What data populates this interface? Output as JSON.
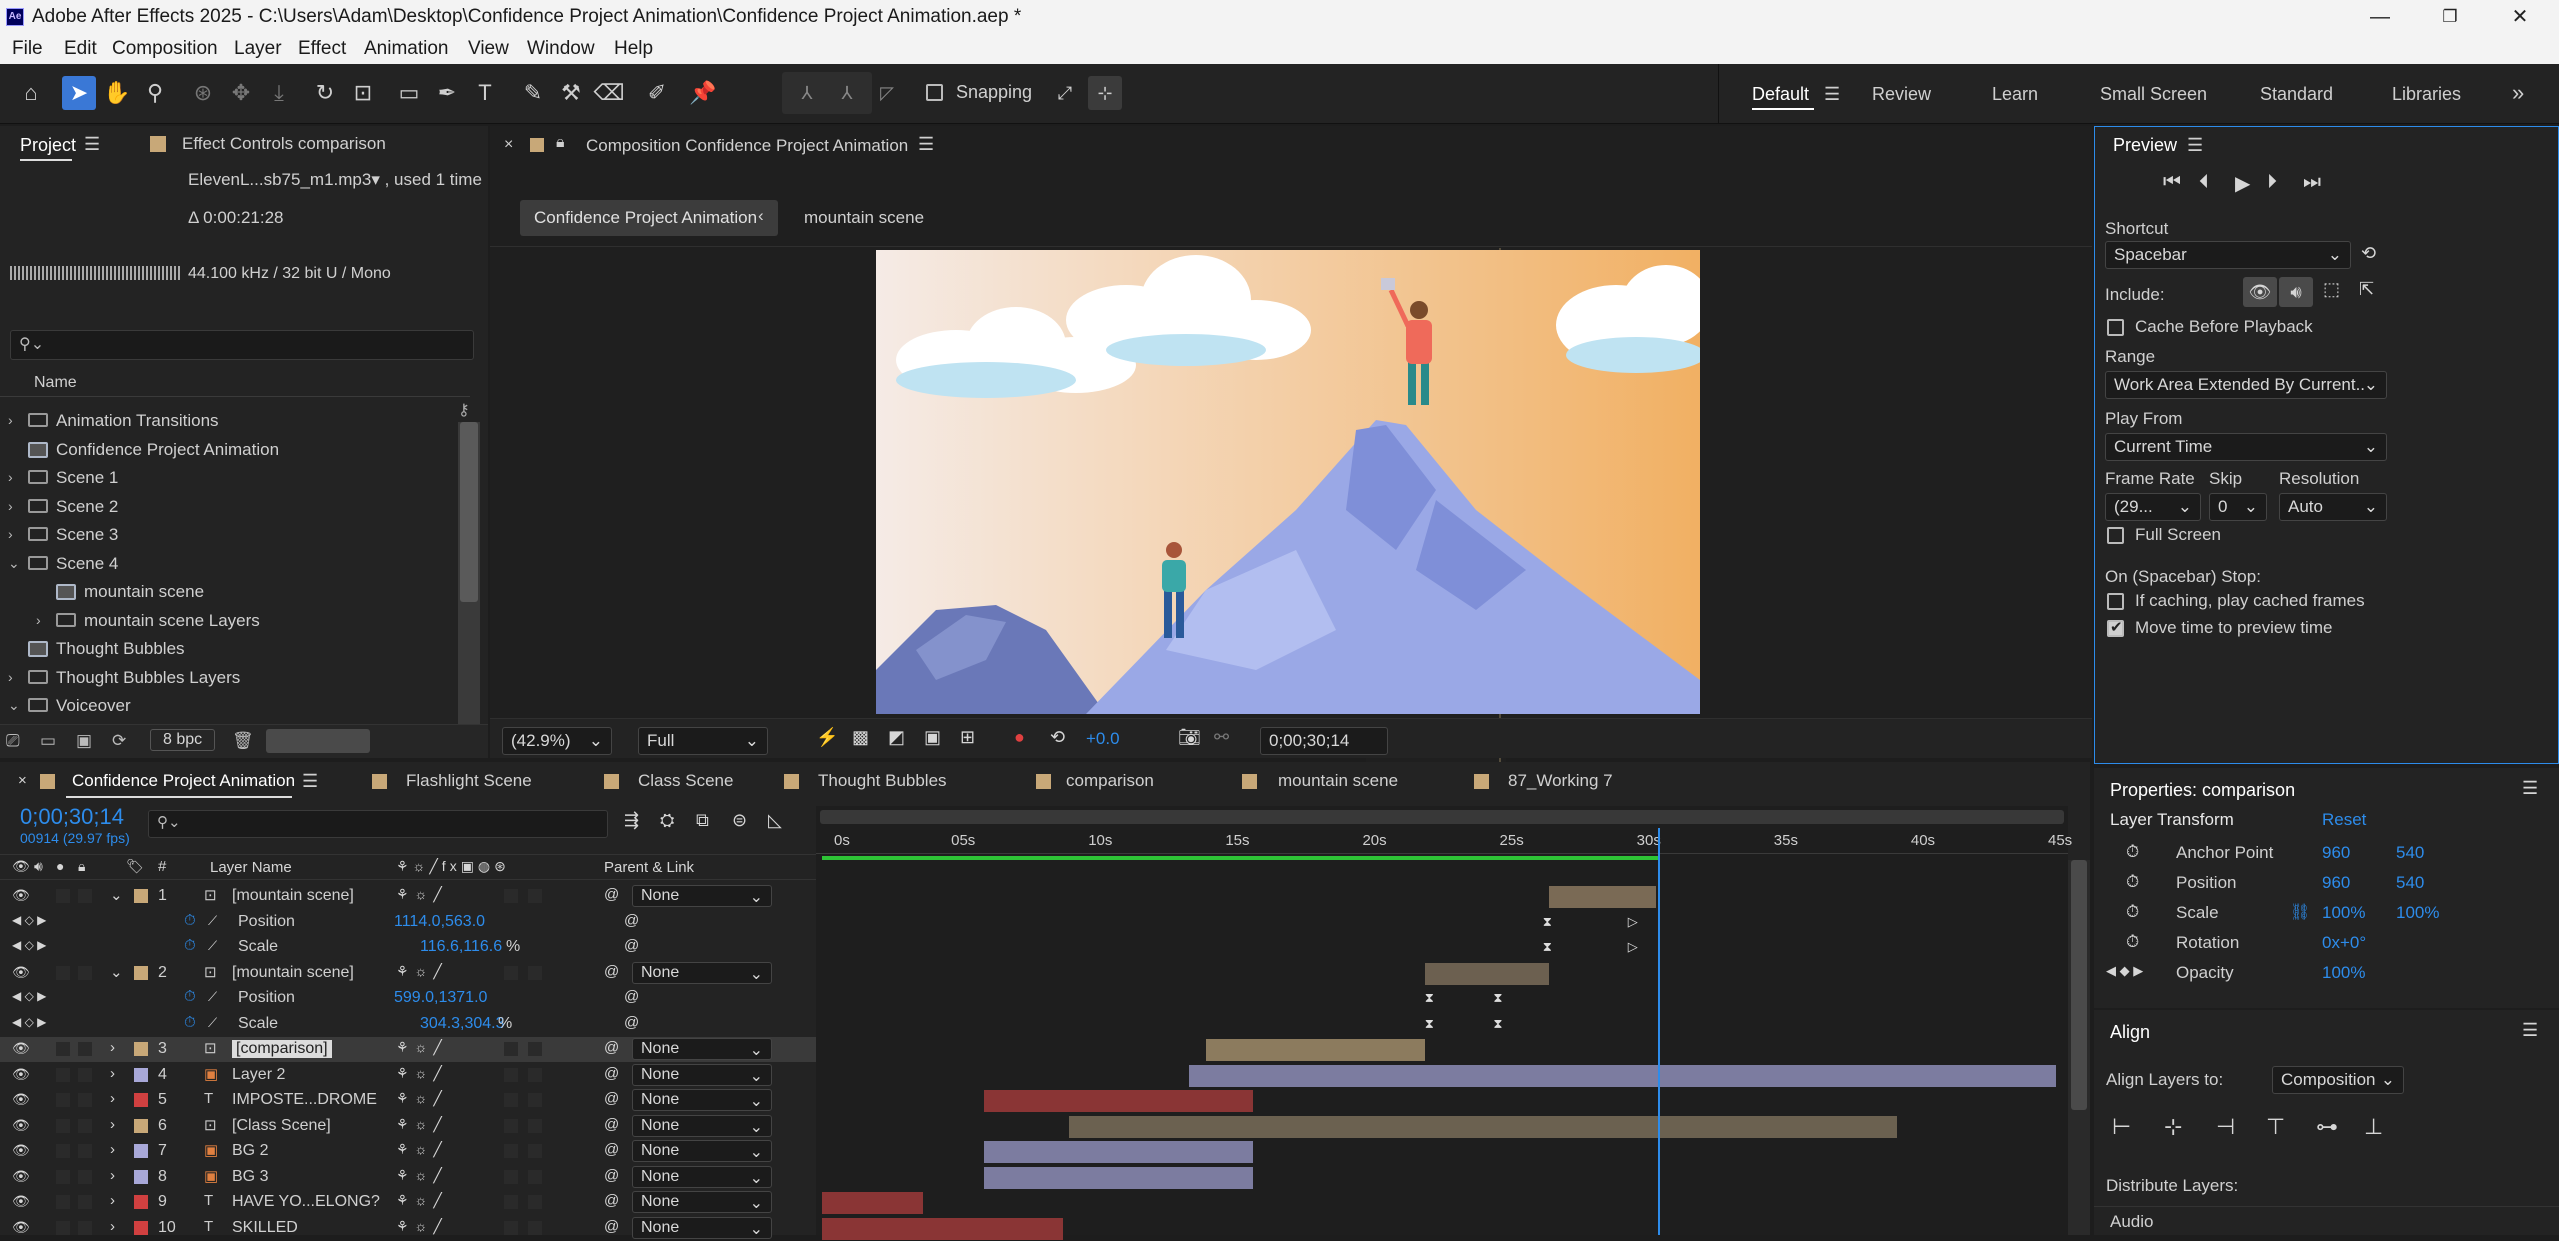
{
  "window": {
    "app_icon": "Ae",
    "title": "Adobe After Effects 2025 - C:\\Users\\Adam\\Desktop\\Confidence Project Animation\\Confidence Project Animation.aep *",
    "minimize": "—",
    "maximize": "❐",
    "close": "✕"
  },
  "menu": [
    "File",
    "Edit",
    "Composition",
    "Layer",
    "Effect",
    "Animation",
    "View",
    "Window",
    "Help"
  ],
  "toolbar": {
    "snapping_label": "Snapping",
    "workspaces": [
      "Default",
      "Review",
      "Learn",
      "Small Screen",
      "Standard",
      "Libraries"
    ],
    "active_workspace": "Default",
    "more": "»"
  },
  "project": {
    "tab_label": "Project",
    "effect_controls_label": "Effect Controls comparison",
    "file_name": "ElevenL...sb75_m1.mp3▾ , used 1 time",
    "duration": "Δ 0:00:21:28",
    "audio_info": "44.100 kHz / 32 bit U / Mono",
    "search_placeholder": "",
    "column_name": "Name",
    "items": [
      {
        "label": "Animation Transitions",
        "type": "folder",
        "expand": "›"
      },
      {
        "label": "Confidence Project Animation",
        "type": "comp",
        "expand": ""
      },
      {
        "label": "Scene 1",
        "type": "folder",
        "expand": "›"
      },
      {
        "label": "Scene 2",
        "type": "folder",
        "expand": "›"
      },
      {
        "label": "Scene 3",
        "type": "folder",
        "expand": "›"
      },
      {
        "label": "Scene 4",
        "type": "folder",
        "expand": "⌄"
      },
      {
        "label": "mountain scene",
        "type": "comp",
        "expand": ""
      },
      {
        "label": "mountain scene Layers",
        "type": "folder",
        "expand": "›"
      },
      {
        "label": "Thought Bubbles",
        "type": "comp",
        "expand": ""
      },
      {
        "label": "Thought Bubbles Layers",
        "type": "folder",
        "expand": "›"
      },
      {
        "label": "Voiceover",
        "type": "folder",
        "expand": "⌄"
      }
    ],
    "bpc": "8 bpc"
  },
  "composition": {
    "tab_label": "Composition Confidence Project Animation",
    "breadcrumb_active": "Confidence Project Animation",
    "breadcrumb_child": "mountain scene",
    "zoom": "(42.9%)",
    "resolution": "Full",
    "exposure": "+0.0",
    "timecode": "0;00;30;14"
  },
  "preview": {
    "title": "Preview",
    "shortcut_label": "Shortcut",
    "shortcut_value": "Spacebar",
    "include_label": "Include:",
    "cache_label": "Cache Before Playback",
    "range_label": "Range",
    "range_value": "Work Area Extended By Current...",
    "play_from_label": "Play From",
    "play_from_value": "Current Time",
    "frame_rate_label": "Frame Rate",
    "frame_rate_value": "(29...",
    "skip_label": "Skip",
    "skip_value": "0",
    "resolution_label": "Resolution",
    "resolution_value": "Auto",
    "full_screen_label": "Full Screen",
    "stop_label": "On (Spacebar) Stop:",
    "if_caching_label": "If caching, play cached frames",
    "move_time_label": "Move time to preview time",
    "move_time_checked": true,
    "cache_checked": false,
    "full_screen_checked": false,
    "if_caching_checked": false
  },
  "properties": {
    "title": "Properties: comparison",
    "section": "Layer Transform",
    "reset": "Reset",
    "rows": [
      {
        "label": "Anchor Point",
        "v1": "960",
        "v2": "540"
      },
      {
        "label": "Position",
        "v1": "960",
        "v2": "540"
      },
      {
        "label": "Scale",
        "v1": "100%",
        "v2": "100%"
      },
      {
        "label": "Rotation",
        "v1": "0x+0°",
        "v2": ""
      },
      {
        "label": "Opacity",
        "v1": "100%",
        "v2": ""
      }
    ]
  },
  "align": {
    "title": "Align",
    "align_to_label": "Align Layers to:",
    "align_to_value": "Composition",
    "distribute_label": "Distribute Layers:",
    "audio_label": "Audio"
  },
  "timeline": {
    "tabs": [
      "Confidence Project Animation",
      "Flashlight Scene",
      "Class Scene",
      "Thought Bubbles",
      "comparison",
      "mountain scene",
      "87_Working 7"
    ],
    "timecode": "0;00;30;14",
    "frame_info": "00914 (29.97 fps)",
    "col_num": "#",
    "col_layer_name": "Layer Name",
    "col_parent": "Parent & Link",
    "ruler_labels": [
      "0s",
      "05s",
      "10s",
      "15s",
      "20s",
      "25s",
      "30s",
      "35s",
      "40s",
      "45s"
    ],
    "ruler_max_seconds": 45,
    "current_time_seconds": 30.5,
    "work_area": [
      0,
      30.5
    ],
    "layers": [
      {
        "num": "1",
        "name": "[mountain scene]",
        "kind": "comp",
        "color": "#c8a878",
        "parent": "None",
        "expanded": true,
        "bar": [
          26.5,
          30.4
        ],
        "bar_color": "#7a6a55"
      },
      {
        "kind": "prop",
        "name": "Position",
        "value": "1114.0,563.0",
        "keys": [
          26.5,
          29.6
        ]
      },
      {
        "kind": "prop",
        "name": "Scale",
        "value": "116.6,116.6",
        "unit": "%",
        "keys": [
          26.5,
          29.6
        ]
      },
      {
        "num": "2",
        "name": "[mountain scene]",
        "kind": "comp",
        "color": "#c8a878",
        "parent": "None",
        "expanded": true,
        "bar": [
          22.0,
          26.5
        ],
        "bar_color": "#6c6050"
      },
      {
        "kind": "prop",
        "name": "Position",
        "value": "599.0,1371.0",
        "keys": [
          22.2,
          24.7
        ]
      },
      {
        "kind": "prop",
        "name": "Scale",
        "value": "304.3,304.3",
        "unit": "%",
        "keys": [
          22.2,
          24.7
        ]
      },
      {
        "num": "3",
        "name": "[comparison]",
        "kind": "comp",
        "color": "#c8a878",
        "parent": "None",
        "selected": true,
        "bar": [
          14.0,
          22.0
        ],
        "bar_color": "#8c7b5e"
      },
      {
        "num": "4",
        "name": "Layer 2",
        "kind": "img",
        "color": "#a8a8d8",
        "parent": "None",
        "bar": [
          13.4,
          45
        ],
        "bar_color": "#7c7ca0"
      },
      {
        "num": "5",
        "name": "IMPOSTE...DROME",
        "kind": "text",
        "color": "#d04040",
        "parent": "None",
        "bar": [
          5.9,
          15.7
        ],
        "bar_color": "#8a3535"
      },
      {
        "num": "6",
        "name": "[Class Scene]",
        "kind": "comp",
        "color": "#c8a878",
        "parent": "None",
        "bar": [
          9.0,
          39.2
        ],
        "bar_color": "#6b6150"
      },
      {
        "num": "7",
        "name": "BG 2",
        "kind": "img",
        "color": "#a8a8d8",
        "parent": "None",
        "bar": [
          5.9,
          15.7
        ],
        "bar_color": "#7c7ca0"
      },
      {
        "num": "8",
        "name": "BG 3",
        "kind": "img",
        "color": "#a8a8d8",
        "parent": "None",
        "bar": [
          5.9,
          15.7
        ],
        "bar_color": "#7c7ca0"
      },
      {
        "num": "9",
        "name": "HAVE YO...ELONG?",
        "kind": "text",
        "color": "#d04040",
        "parent": "None",
        "bar": [
          0,
          3.7
        ],
        "bar_color": "#8a3535"
      },
      {
        "num": "10",
        "name": "SKILLED",
        "kind": "text",
        "color": "#d04040",
        "parent": "None",
        "bar": [
          0,
          8.8
        ],
        "bar_color": "#8a3535"
      }
    ]
  },
  "colors": {
    "accent": "#2d8ceb",
    "panel": "#232323",
    "selected_tool": "#3a78d6"
  }
}
